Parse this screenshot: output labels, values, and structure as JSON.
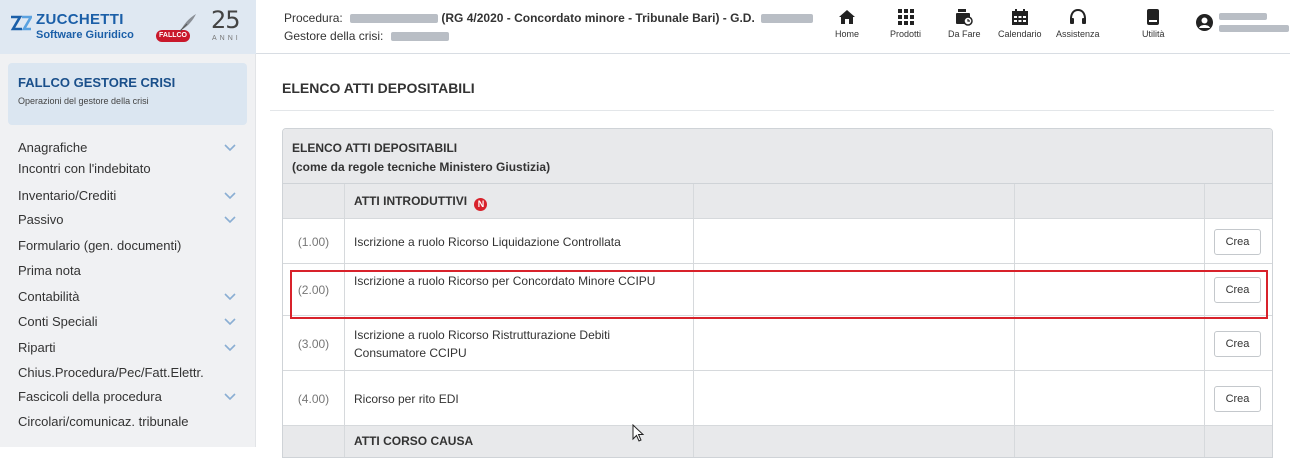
{
  "header": {
    "brand": "ZUCCHETTI",
    "brand_sub": "Software Giuridico",
    "badge": "FALLCO",
    "anni_num": "25",
    "anni_txt": "ANNI",
    "procedura_label": "Procedura:",
    "procedura_text": "(RG 4/2020 - Concordato minore - Tribunale Bari) - G.D.",
    "gestore_label": "Gestore della crisi:",
    "nav": [
      {
        "label": "Home",
        "icon": "home-icon"
      },
      {
        "label": "Prodotti",
        "icon": "grid-icon"
      },
      {
        "label": "Da Fare",
        "icon": "todo-icon"
      },
      {
        "label": "Calendario",
        "icon": "calendar-icon"
      },
      {
        "label": "Assistenza",
        "icon": "headset-icon"
      },
      {
        "label": "Utilità",
        "icon": "book-icon"
      }
    ]
  },
  "sidebar": {
    "title": "FALLCO GESTORE CRISI",
    "subtitle": "Operazioni del gestore della crisi",
    "items": [
      {
        "label": "Anagrafiche",
        "expandable": true
      },
      {
        "label": "Incontri con l'indebitato",
        "expandable": false
      },
      {
        "label": "Inventario/Crediti",
        "expandable": true
      },
      {
        "label": "Passivo",
        "expandable": true
      },
      {
        "label": "Formulario (gen. documenti)",
        "expandable": false
      },
      {
        "label": "Prima nota",
        "expandable": false
      },
      {
        "label": "Contabilità",
        "expandable": true
      },
      {
        "label": "Conti Speciali",
        "expandable": true
      },
      {
        "label": "Riparti",
        "expandable": true
      },
      {
        "label": "Chius.Procedura/Pec/Fatt.Elettr.",
        "expandable": false
      },
      {
        "label": "Fascicoli della procedura",
        "expandable": true
      },
      {
        "label": "Circolari/comunicaz. tribunale",
        "expandable": false
      }
    ]
  },
  "main": {
    "title": "ELENCO ATTI DEPOSITABILI",
    "panel_title": "ELENCO ATTI DEPOSITABILI",
    "panel_subtitle": "(come da regole tecniche Ministero Giustizia)",
    "section1": "ATTI INTRODUTTIVI",
    "section1_badge": "N",
    "rows": [
      {
        "num": "(1.00)",
        "desc": "Iscrizione a ruolo Ricorso Liquidazione Controllata",
        "button": "Crea"
      },
      {
        "num": "(2.00)",
        "desc": "Iscrizione a ruolo Ricorso per Concordato Minore CCIPU",
        "button": "Crea"
      },
      {
        "num": "(3.00)",
        "desc": "Iscrizione a ruolo Ricorso Ristrutturazione Debiti Consumatore CCIPU",
        "button": "Crea"
      },
      {
        "num": "(4.00)",
        "desc": "Ricorso per rito EDI",
        "button": "Crea"
      }
    ],
    "section2": "ATTI CORSO CAUSA"
  },
  "colors": {
    "brand_blue": "#1b5fa8",
    "highlight_red": "#d8222b",
    "badge_red": "#c9182b"
  }
}
